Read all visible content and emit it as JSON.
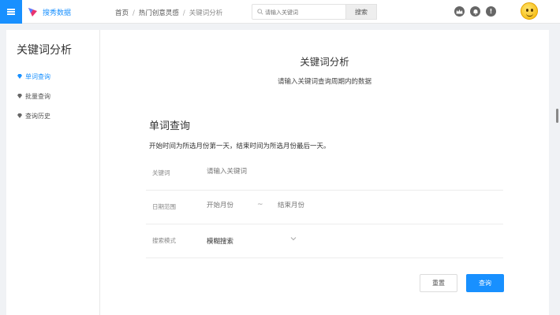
{
  "header": {
    "brand": "搜秀数据",
    "breadcrumb": [
      "首页",
      "热门创意灵感",
      "关键词分析"
    ],
    "search": {
      "placeholder": "请输入关键词",
      "button": "搜索"
    },
    "icons": [
      "crown-icon",
      "bell-icon",
      "alert-icon",
      "avatar"
    ]
  },
  "sidebar": {
    "title": "关键词分析",
    "items": [
      {
        "label": "单词查询",
        "active": true
      },
      {
        "label": "批量查询",
        "active": false
      },
      {
        "label": "查询历史",
        "active": false
      }
    ]
  },
  "main": {
    "title": "关键词分析",
    "subtitle": "请输入关键词查询周期内的数据",
    "section_title": "单词查询",
    "section_desc": "开始时间为所选月份第一天，结束时间为所选月份最后一天。",
    "form": {
      "keyword": {
        "label": "关键词",
        "placeholder": "请输入关键词"
      },
      "date_range": {
        "label": "日期范围",
        "start_placeholder": "开始月份",
        "separator": "~",
        "end_placeholder": "结束月份"
      },
      "mode": {
        "label": "搜索模式",
        "value": "模糊搜索"
      }
    },
    "buttons": {
      "reset": "重置",
      "query": "查询"
    }
  },
  "colors": {
    "accent": "#1890ff",
    "background": "#f0f2f5"
  }
}
